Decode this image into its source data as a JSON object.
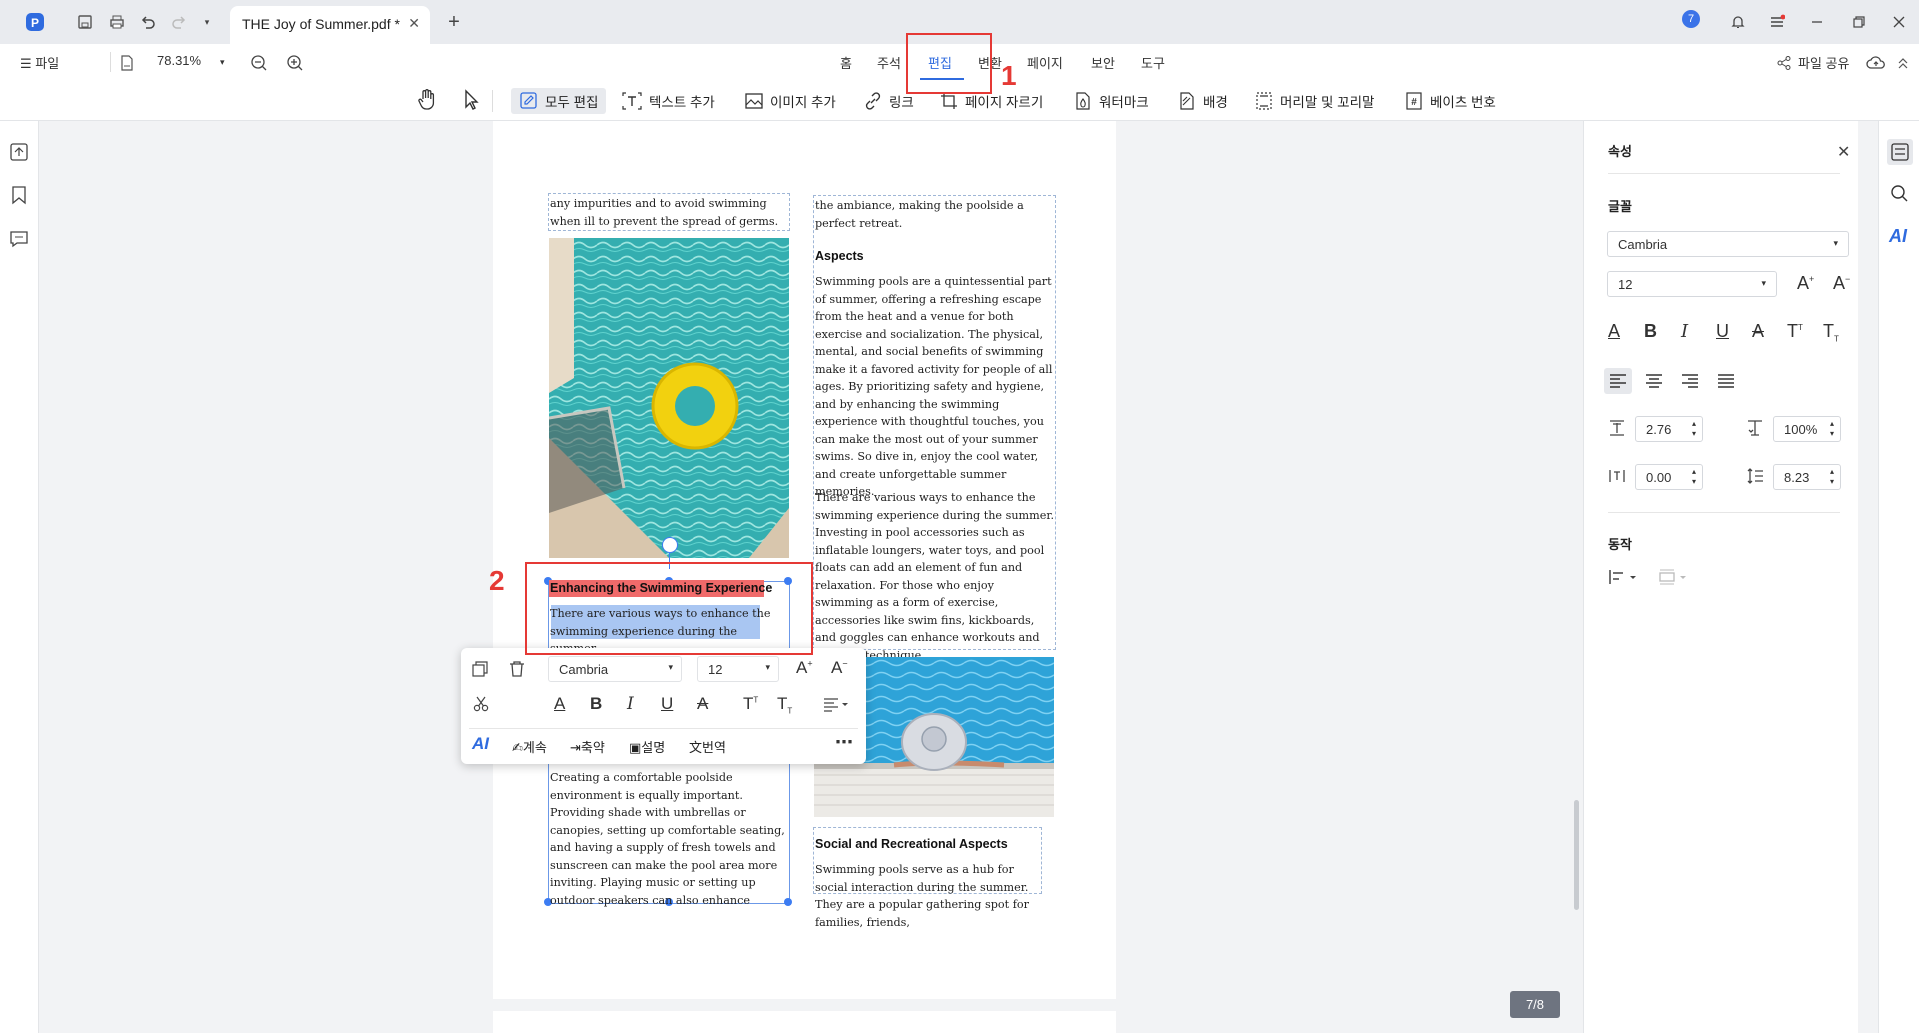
{
  "titlebar": {
    "doc_tab": "THE Joy of Summer.pdf *",
    "notification_count": "7"
  },
  "menubar": {
    "file": "파일",
    "zoom": "78.31%",
    "tabs": [
      "홈",
      "주석",
      "편집",
      "변환",
      "페이지",
      "보안",
      "도구"
    ],
    "active_tab": "편집",
    "share": "파일 공유"
  },
  "edit_toolbar": {
    "edit_all": "모두 편집",
    "add_text": "텍스트 추가",
    "add_image": "이미지 추가",
    "link": "링크",
    "crop_page": "페이지 자르기",
    "watermark": "워터마크",
    "background": "배경",
    "header_footer": "머리말 및 꼬리말",
    "bates": "베이츠 번호"
  },
  "document": {
    "col1_top": "any impurities and to avoid swimming when ill to prevent the spread of germs.",
    "col1_heading": "Enhancing the Swimming Experience",
    "col1_selected": "There are various ways to enhance the swimming experience during the summer.",
    "col1_bottom": "Creating a comfortable poolside environment is equally important. Providing shade with umbrellas or canopies, setting up comfortable seating, and having a supply of fresh towels and sunscreen can make the pool area more inviting. Playing music or setting up outdoor speakers can also enhance",
    "col2_top": "the ambiance, making the poolside a perfect retreat.",
    "col2_heading": "Aspects",
    "col2_p1": "Swimming pools are a quintessential part of summer, offering a refreshing escape from the heat and a venue for both exercise and socialization. The physical, mental, and social benefits of swimming make it a favored activity for people of all ages. By prioritizing safety and hygiene, and by enhancing the swimming experience with thoughtful touches, you can make the most out of your summer swims. So dive in, enjoy the cool water, and create unforgettable summer memories.",
    "col2_p2": "There are various ways to enhance the swimming experience during the summer. Investing in pool accessories such as inflatable loungers, water toys, and pool floats can add an element of fun and relaxation. For those who enjoy swimming as a form of exercise, accessories like swim fins, kickboards, and goggles can enhance workouts and improve technique.",
    "col2_heading2": "Social and Recreational Aspects",
    "col2_p3": "Swimming pools serve as a hub for social interaction during the summer. They are a popular gathering spot for families, friends,",
    "page_indicator": "7/8"
  },
  "float_toolbar": {
    "font": "Cambria",
    "size": "12",
    "continue": "계속",
    "summarize": "축약",
    "explain": "설명",
    "translate": "번역",
    "ai": "AI"
  },
  "properties": {
    "title": "속성",
    "font_section": "글꼴",
    "font": "Cambria",
    "size": "12",
    "char_spacing": "2.76",
    "scale": "100%",
    "word_spacing": "0.00",
    "line_spacing": "8.23",
    "action_section": "동작"
  },
  "annotations": {
    "one": "1",
    "two": "2"
  },
  "colors": {
    "accent": "#2f6bdf",
    "highlight_red": "#f06a6a",
    "selection": "#a9c6f2",
    "callout": "#e53935"
  }
}
